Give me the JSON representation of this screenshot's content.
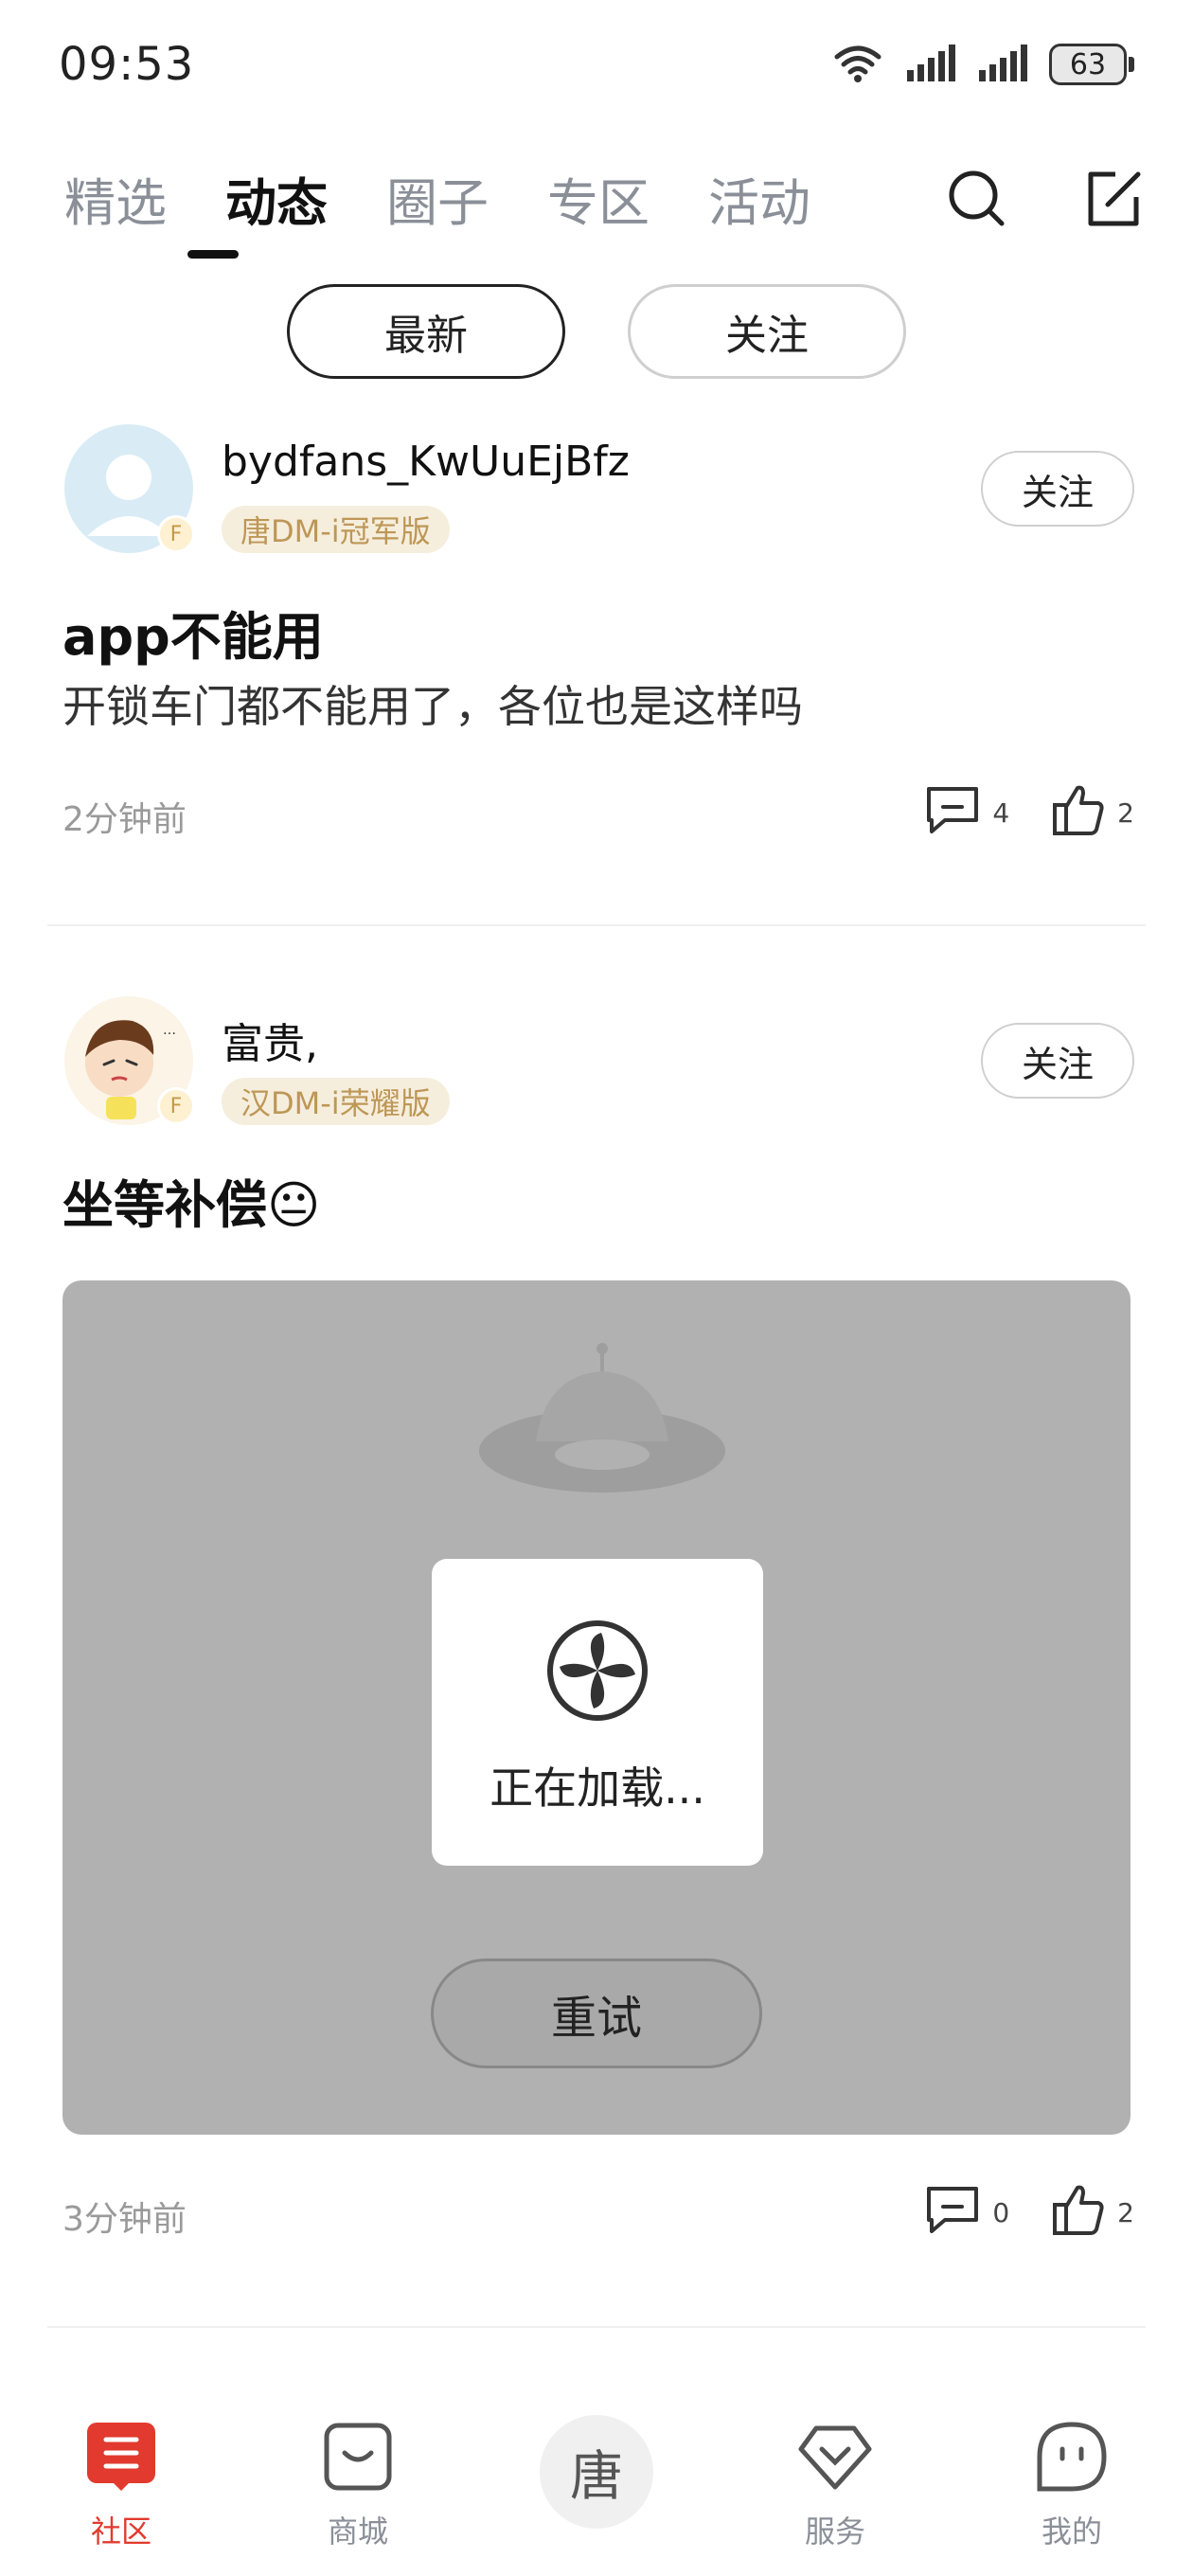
{
  "status_bar": {
    "time": "09:53",
    "battery": "63"
  },
  "top_tabs": [
    {
      "label": "精选",
      "active": false
    },
    {
      "label": "动态",
      "active": true
    },
    {
      "label": "圈子",
      "active": false
    },
    {
      "label": "专区",
      "active": false
    },
    {
      "label": "活动",
      "active": false
    }
  ],
  "sub_tabs": [
    {
      "label": "最新",
      "active": true
    },
    {
      "label": "关注",
      "active": false
    }
  ],
  "posts": [
    {
      "username": "bydfans_KwUuEjBfz",
      "car_tag": "唐DM-i冠军版",
      "badge": "F",
      "follow_label": "关注",
      "title": "app不能用",
      "body": "开锁车门都不能用了，各位也是这样吗",
      "time": "2分钟前",
      "comments": "4",
      "likes": "2"
    },
    {
      "username": "富贵,",
      "car_tag": "汉DM-i荣耀版",
      "badge": "F",
      "follow_label": "关注",
      "title": "坐等补偿😐",
      "time": "3分钟前",
      "comments": "0",
      "likes": "2",
      "image_loading": {
        "text": "正在加载...",
        "retry_label": "重试"
      }
    }
  ],
  "bottom_nav": [
    {
      "label": "社区",
      "icon": "community-icon",
      "active": true
    },
    {
      "label": "商城",
      "icon": "shop-icon",
      "active": false
    },
    {
      "label": "唐",
      "icon": "center-logo",
      "active": false
    },
    {
      "label": "服务",
      "icon": "service-icon",
      "active": false
    },
    {
      "label": "我的",
      "icon": "profile-icon",
      "active": false
    }
  ],
  "colors": {
    "accent": "#e23a2e",
    "tag_bg": "#f6eedd",
    "tag_text": "#bd9756"
  }
}
